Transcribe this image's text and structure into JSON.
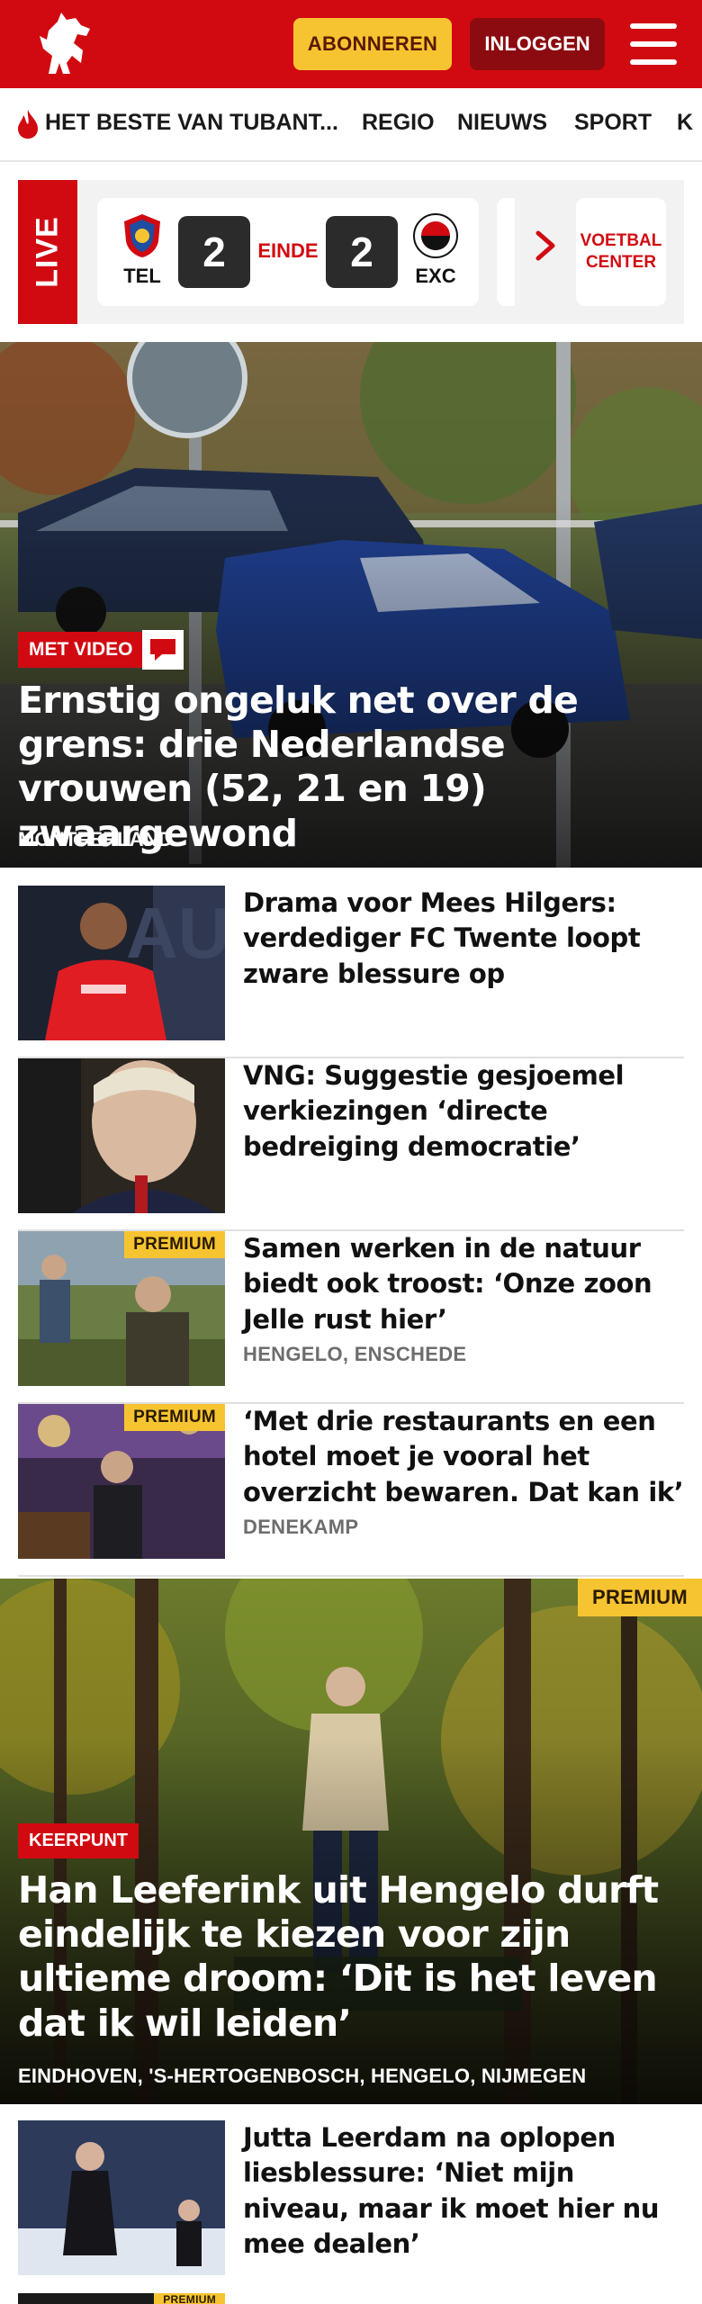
{
  "header": {
    "subscribe_label": "ABONNEREN",
    "login_label": "INLOGGEN",
    "brand_color": "#d10a11",
    "accent_color": "#f7c431"
  },
  "nav": {
    "items": [
      "HET BESTE VAN TUBANT...",
      "REGIO",
      "NIEUWS",
      "SPORT",
      "K"
    ]
  },
  "live": {
    "tag": "LIVE",
    "home_team": "TEL",
    "away_team": "EXC",
    "home_score": "2",
    "away_score": "2",
    "status": "EINDE",
    "voetbal_center": "VOETBAL CENTER"
  },
  "hero1": {
    "label": "MET VIDEO",
    "title": "Ernstig ongeluk net over de grens: drie Nederlandse vrouwen (52, 21 en 19) zwaargewond",
    "location": "MONTFERLAND"
  },
  "articles": [
    {
      "title": "Drama voor Mees Hilgers: verdediger FC Twente loopt zware blessure op",
      "meta": "",
      "premium": ""
    },
    {
      "title": "VNG: Suggestie gesjoemel verkiezingen ‘directe bedreiging democratie’",
      "meta": "",
      "premium": ""
    },
    {
      "title": "Samen werken in de natuur biedt ook troost: ‘Onze zoon Jelle rust hier’",
      "meta": "HENGELO, ENSCHEDE",
      "premium": "PREMIUM"
    },
    {
      "title": "‘Met drie restaurants en een hotel moet je vooral het overzicht bewaren. Dat kan ik’",
      "meta": "DENEKAMP",
      "premium": "PREMIUM"
    }
  ],
  "hero2": {
    "premium": "PREMIUM",
    "label": "KEERPUNT",
    "title": "Han Leeferink uit Hengelo durft eindelijk te kiezen voor zijn ultieme droom: ‘Dit is het leven dat ik wil leiden’",
    "location": "EINDHOVEN, 'S-HERTOGENBOSCH, HENGELO, NIJMEGEN"
  },
  "article_last": {
    "title": "Jutta Leerdam na oplopen liesblessure: ‘Niet mijn niveau, maar ik moet hier nu mee dealen’",
    "next_premium": "PREMIUM"
  }
}
